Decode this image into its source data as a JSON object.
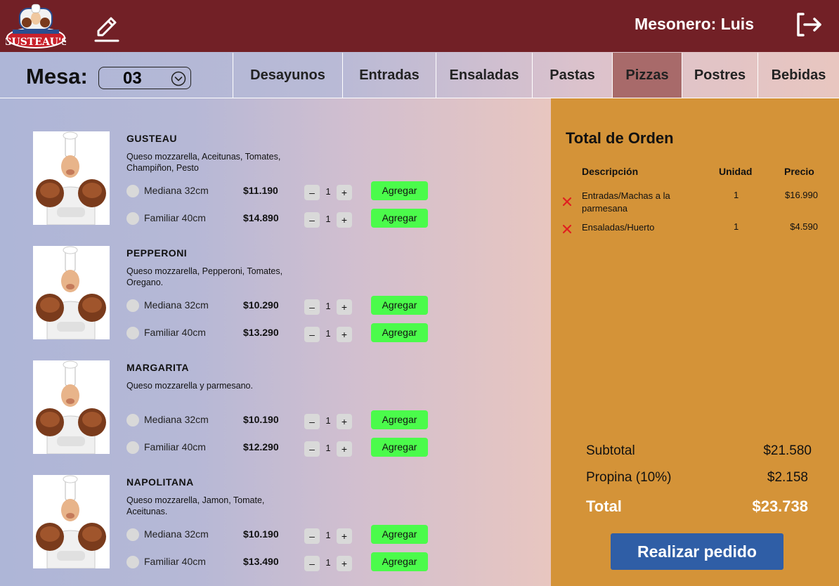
{
  "header": {
    "logo_text": "GUSTEAU'S",
    "waiter_label": "Mesonero: Luis",
    "icons": {
      "edit": "edit-pencil-icon",
      "logout": "logout-icon"
    },
    "colors": {
      "header_bg": "#722026",
      "order_panel_bg": "#d49338",
      "add_button": "#4bfb4b",
      "submit_button": "#2f5ea6",
      "remove_icon": "#e02020"
    }
  },
  "table_selector": {
    "label": "Mesa:",
    "selected": "03"
  },
  "tabs": [
    {
      "label": "Desayunos",
      "active": false
    },
    {
      "label": "Entradas",
      "active": false
    },
    {
      "label": "Ensaladas",
      "active": false
    },
    {
      "label": "Pastas",
      "active": false
    },
    {
      "label": "Pizzas",
      "active": true
    },
    {
      "label": "Postres",
      "active": false
    },
    {
      "label": "Bebidas",
      "active": false
    }
  ],
  "pizzas": [
    {
      "name": "GUSTEAU",
      "description": "Queso mozzarella, Aceitunas, Tomates, Champiñon, Pesto",
      "sizes": [
        {
          "label": "Mediana 32cm",
          "price": "$11.190",
          "qty": "1",
          "add_label": "Agregar"
        },
        {
          "label": "Familiar 40cm",
          "price": "$14.890",
          "qty": "1",
          "add_label": "Agregar"
        }
      ]
    },
    {
      "name": "PEPPERONI",
      "description": "Queso mozzarella, Pepperoni, Tomates, Oregano.",
      "sizes": [
        {
          "label": "Mediana 32cm",
          "price": "$10.290",
          "qty": "1",
          "add_label": "Agregar"
        },
        {
          "label": "Familiar 40cm",
          "price": "$13.290",
          "qty": "1",
          "add_label": "Agregar"
        }
      ]
    },
    {
      "name": "MARGARITA",
      "description": "Queso mozzarella y parmesano.",
      "sizes": [
        {
          "label": "Mediana 32cm",
          "price": "$10.190",
          "qty": "1",
          "add_label": "Agregar"
        },
        {
          "label": "Familiar 40cm",
          "price": "$12.290",
          "qty": "1",
          "add_label": "Agregar"
        }
      ]
    },
    {
      "name": "NAPOLITANA",
      "description": "Queso mozzarella, Jamon, Tomate, Aceitunas.",
      "sizes": [
        {
          "label": "Mediana 32cm",
          "price": "$10.190",
          "qty": "1",
          "add_label": "Agregar"
        },
        {
          "label": "Familiar 40cm",
          "price": "$13.490",
          "qty": "1",
          "add_label": "Agregar"
        }
      ]
    }
  ],
  "qty_buttons": {
    "minus": "–",
    "plus": "+"
  },
  "order": {
    "title": "Total de Orden",
    "headers": {
      "description": "Descripción",
      "unit": "Unidad",
      "price": "Precio"
    },
    "items": [
      {
        "description": "Entradas/Machas a la parmesana",
        "unit": "1",
        "price": "$16.990"
      },
      {
        "description": "Ensaladas/Huerto",
        "unit": "1",
        "price": "$4.590"
      }
    ],
    "subtotal_label": "Subtotal",
    "subtotal": "$21.580",
    "tip_label": "Propina (10%)",
    "tip": "$2.158",
    "total_label": "Total",
    "total": "$23.738",
    "submit_label": "Realizar pedido"
  }
}
